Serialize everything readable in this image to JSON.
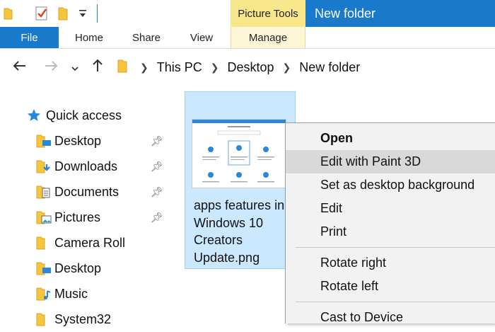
{
  "titlebar": {
    "contextual_tab_group": "Picture Tools",
    "window_title": "New folder"
  },
  "ribbon": {
    "tabs": [
      "File",
      "Home",
      "Share",
      "View",
      "Manage"
    ]
  },
  "address": {
    "crumbs": [
      "This PC",
      "Desktop",
      "New folder"
    ]
  },
  "sidebar": {
    "quick_access": "Quick access",
    "items": [
      {
        "label": "Desktop",
        "icon": "desktop-folder-icon",
        "pinned": true
      },
      {
        "label": "Downloads",
        "icon": "downloads-folder-icon",
        "pinned": true
      },
      {
        "label": "Documents",
        "icon": "documents-folder-icon",
        "pinned": true
      },
      {
        "label": "Pictures",
        "icon": "pictures-folder-icon",
        "pinned": true
      },
      {
        "label": "Camera Roll",
        "icon": "folder-icon",
        "pinned": false
      },
      {
        "label": "Desktop",
        "icon": "desktop-folder-icon",
        "pinned": false
      },
      {
        "label": "Music",
        "icon": "music-folder-icon",
        "pinned": false
      },
      {
        "label": "System32",
        "icon": "folder-icon",
        "pinned": false
      }
    ]
  },
  "file": {
    "name_lines": [
      "apps features in",
      "Windows 10",
      "Creators",
      "Update.png"
    ]
  },
  "context_menu": {
    "items": [
      {
        "label": "Open",
        "bold": true
      },
      {
        "label": "Edit with Paint 3D",
        "highlighted": true
      },
      {
        "label": "Set as desktop background"
      },
      {
        "label": "Edit"
      },
      {
        "label": "Print"
      },
      {
        "label": "Rotate right"
      },
      {
        "label": "Rotate left"
      },
      {
        "label": "Cast to Device"
      }
    ]
  },
  "colors": {
    "accent": "#1979ca",
    "contextual": "#f8e68a",
    "selection": "#cce8ff",
    "menu_bg": "#f2f2f2",
    "menu_highlight": "#d9d9d9"
  }
}
